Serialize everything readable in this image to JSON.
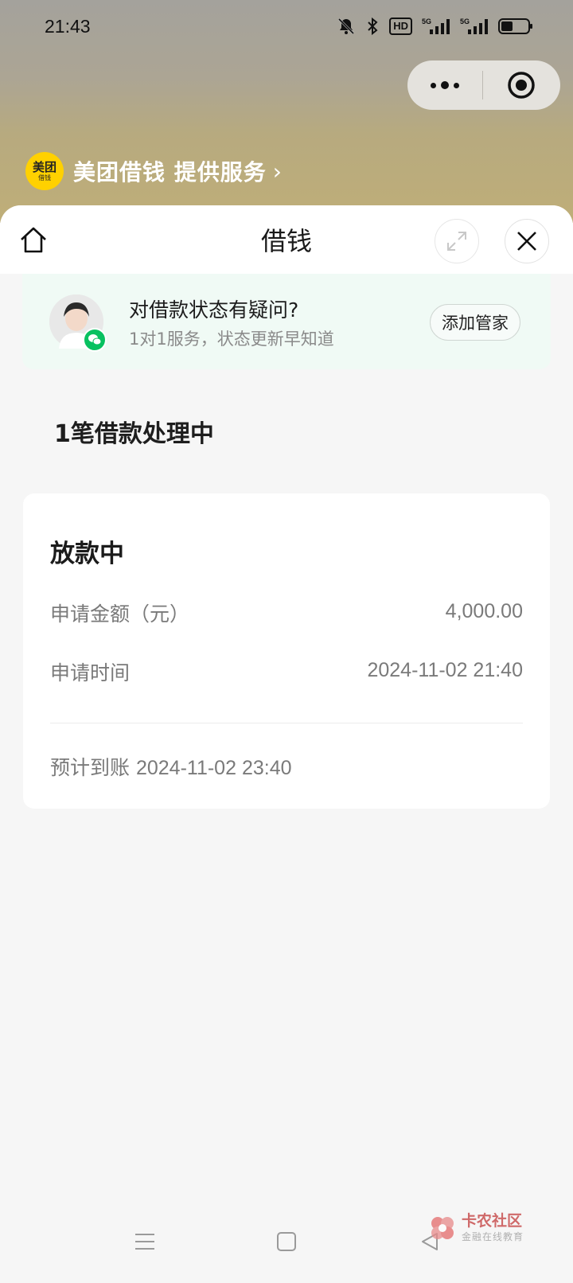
{
  "status_bar": {
    "time": "21:43",
    "icons": [
      "bell-muted-icon",
      "bluetooth-icon",
      "hd-icon",
      "signal-5g-icon",
      "signal-5g-icon",
      "battery-icon"
    ],
    "hd_label": "HD"
  },
  "capsule": {
    "more_icon": "more-dots-icon",
    "close_icon": "target-circle-icon"
  },
  "brand": {
    "logo_text": "美团",
    "logo_sub": "借钱",
    "text": "美团借钱 提供服务",
    "arrow": "›"
  },
  "nav": {
    "title": "借钱",
    "home_icon": "home-icon",
    "expand_icon": "expand-icon",
    "close_icon": "close-icon"
  },
  "service": {
    "title": "对借款状态有疑问?",
    "subtitle": "1对1服务，状态更新早知道",
    "button": "添加管家",
    "accent": "#08c160"
  },
  "pending": {
    "count_text": "1笔借款处理中"
  },
  "loan": {
    "status": "放款中",
    "rows": [
      {
        "label": "申请金额（元）",
        "value": "4,000.00"
      },
      {
        "label": "申请时间",
        "value": "2024-11-02 21:40"
      }
    ],
    "eta_label": "预计到账",
    "eta_time": "2024-11-02 23:40"
  },
  "watermark": {
    "title": "卡农社区",
    "subtitle": "金融在线教育"
  },
  "system_nav": [
    "menu-icon",
    "home-square-icon",
    "back-triangle-icon"
  ]
}
